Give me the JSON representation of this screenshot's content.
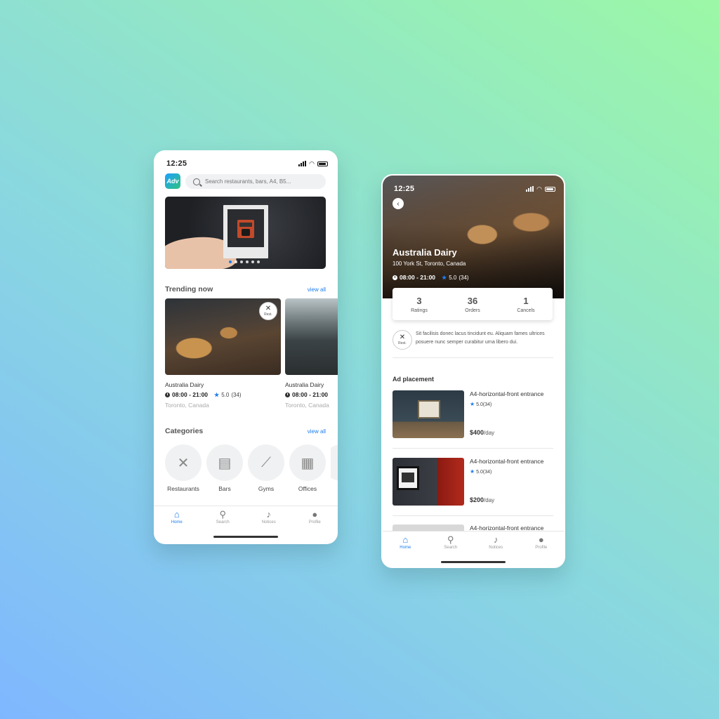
{
  "left_phone": {
    "status": {
      "time": "12:25"
    },
    "logo_text": "Adv",
    "search": {
      "placeholder": "Search restaurants, bars, A4, B5..."
    },
    "trending": {
      "title": "Trending now",
      "view_all": "view all",
      "badge": "Rest.",
      "cards": [
        {
          "name": "Australia Dairy",
          "hours": "08:00 - 21:00",
          "rating": "5.0",
          "count": "(34)",
          "location": "Toronto, Canada"
        },
        {
          "name": "Australia Dairy",
          "hours": "08:00 - 21:00",
          "location": "Toronto, Canada"
        }
      ]
    },
    "categories": {
      "title": "Categories",
      "view_all": "view all",
      "items": [
        {
          "label": "Restaurants",
          "icon": "fork-spoon-icon"
        },
        {
          "label": "Bars",
          "icon": "beer-icon"
        },
        {
          "label": "Gyms",
          "icon": "dumbbell-icon"
        },
        {
          "label": "Offices",
          "icon": "building-icon"
        }
      ]
    },
    "tabs": [
      {
        "label": "Home",
        "icon": "home-icon",
        "active": true
      },
      {
        "label": "Search",
        "icon": "search-icon"
      },
      {
        "label": "Notices",
        "icon": "bell-icon"
      },
      {
        "label": "Profile",
        "icon": "person-icon"
      }
    ]
  },
  "right_phone": {
    "status": {
      "time": "12:25"
    },
    "venue": {
      "name": "Australia Dairy",
      "address": "100 York St, Toronto, Canada",
      "hours": "08:00 - 21:00",
      "rating": "5.0",
      "count": "(34)"
    },
    "stats": [
      {
        "value": "3",
        "label": "Ratings"
      },
      {
        "value": "36",
        "label": "Orders"
      },
      {
        "value": "1",
        "label": "Cancels"
      }
    ],
    "badge": "Rest.",
    "description": "Sit facilisis donec lacus tincidunt eu. Aliquam fames ultrices posuere nunc semper curabitur urna libero dui.",
    "ad_section_title": "Ad placement",
    "ads": [
      {
        "title": "A4-horizontal-front entrance",
        "rating": "5.0",
        "count": "(34)",
        "price": "$400",
        "unit": "/day"
      },
      {
        "title": "A4-horizontal-front entrance",
        "rating": "5.0",
        "count": "(34)",
        "price": "$200",
        "unit": "/day"
      },
      {
        "title": "A4-horizontal-front entrance"
      }
    ],
    "tabs": [
      {
        "label": "Home",
        "icon": "home-icon",
        "active": true
      },
      {
        "label": "Search",
        "icon": "search-icon"
      },
      {
        "label": "Notices",
        "icon": "bell-icon"
      },
      {
        "label": "Profile",
        "icon": "person-icon"
      }
    ]
  },
  "colors": {
    "accent": "#1e7ef0"
  }
}
